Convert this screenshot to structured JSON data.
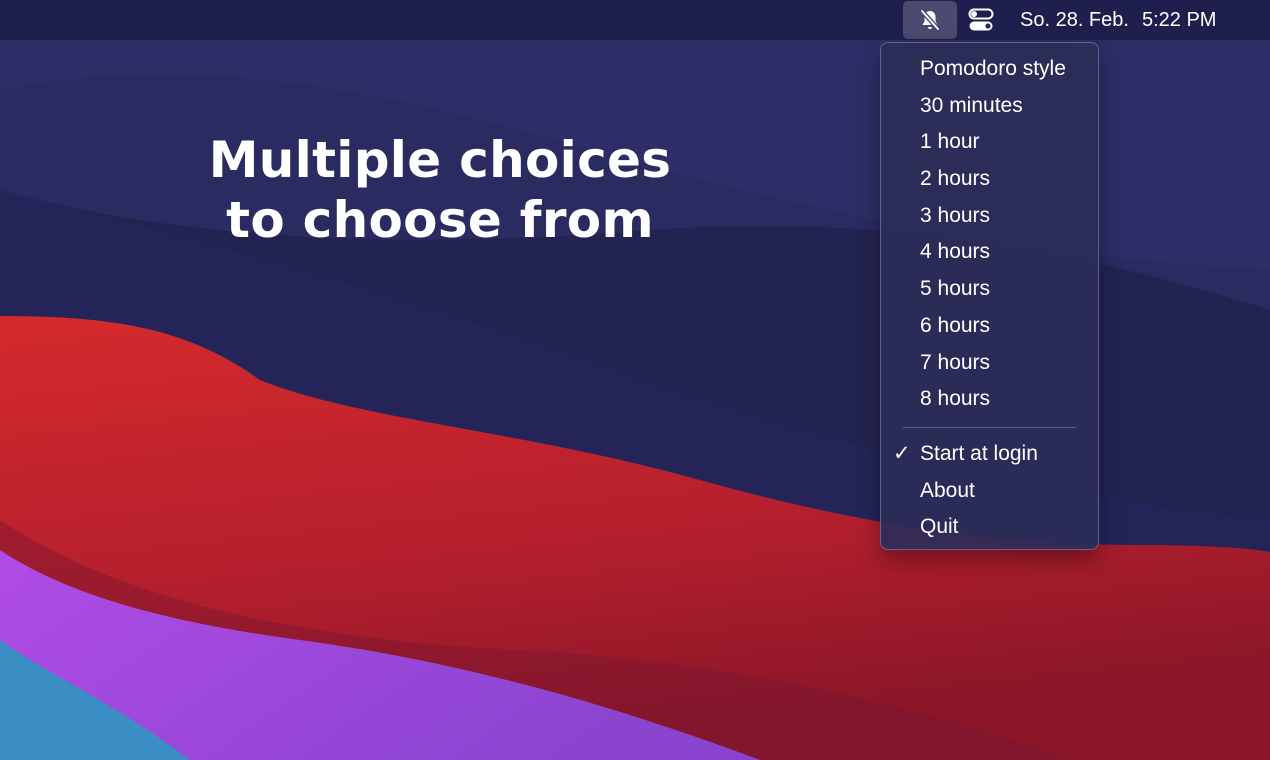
{
  "menubar": {
    "active_icon": "bell-slash-icon",
    "control_icon": "control-center-icon",
    "clock": {
      "date": "So. 28. Feb.",
      "time": "5:22 PM"
    }
  },
  "headline": {
    "line1": "Multiple choices",
    "line2": "to choose from"
  },
  "menu": {
    "durations": [
      "Pomodoro style",
      "30 minutes",
      "1 hour",
      "2 hours",
      "3 hours",
      "4 hours",
      "5 hours",
      "6 hours",
      "7 hours",
      "8 hours"
    ],
    "start_at_login": {
      "checkmark": "✓",
      "label": "Start at login",
      "checked": true
    },
    "about": "About",
    "quit": "Quit"
  },
  "colors": {
    "sky": "#262657",
    "wave_light": "#2e2f68",
    "red": "#c9282d",
    "purple": "#9a47d8",
    "teal": "#3b8ec4",
    "menu_bg": "#2c2c58"
  }
}
